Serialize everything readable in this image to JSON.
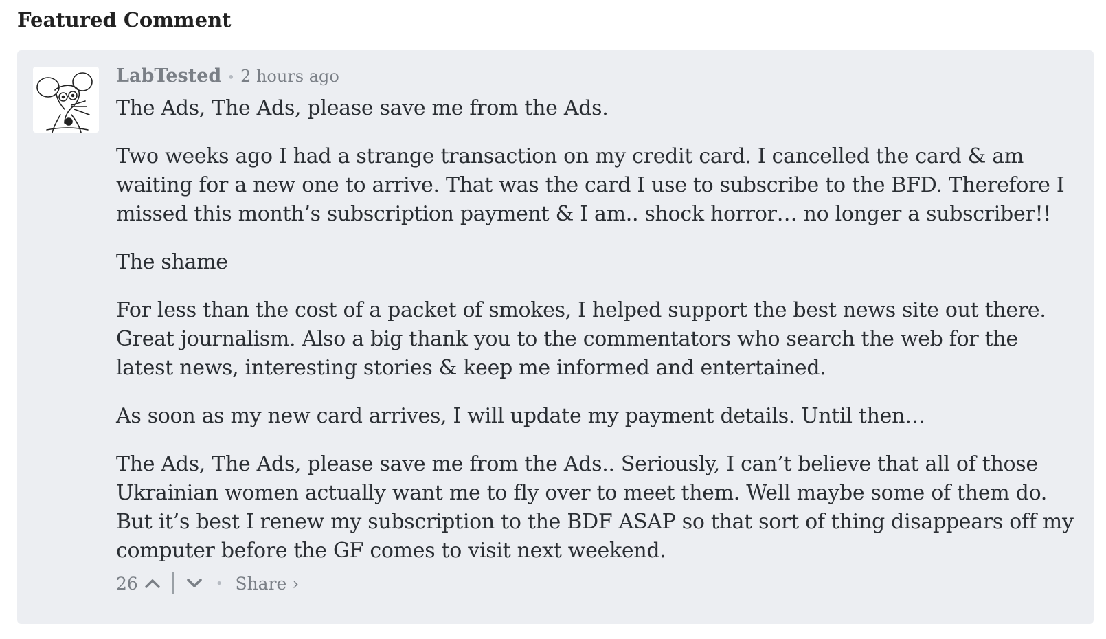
{
  "section_title": "Featured Comment",
  "comment": {
    "author": "LabTested",
    "time": "2 hours ago",
    "paragraphs": [
      "The Ads, The Ads, please save me from the Ads.",
      "Two weeks ago I had a strange transaction on my credit card. I cancelled the card & am waiting for a new one to arrive. That was the card I use to subscribe to the BFD. Therefore I missed this month’s subscription payment & I am.. shock horror… no longer a subscriber!!",
      "The shame",
      "For less than the cost of a packet of smokes, I helped support the best news site out there. Great journalism. Also a big thank you to the commentators who search the web for the latest news, interesting stories & keep me informed and entertained.",
      "As soon as my new card arrives, I will update my payment details. Until then…",
      "The Ads, The Ads, please save me from the Ads.. Seriously, I can’t believe that all of those Ukrainian women actually want me to fly over to meet them. Well maybe some of them do. But it’s best I renew my subscription to the BDF ASAP so that sort of thing disappears off my computer before the GF comes to visit next weekend."
    ],
    "votes": "26",
    "share_label": "Share ›",
    "avatar_icon": "cartoon-rat-avatar",
    "upvote_icon": "chevron-up-icon",
    "downvote_icon": "chevron-down-icon"
  },
  "colors": {
    "card_bg": "#eceef2",
    "muted_text": "#7a7f86",
    "body_text": "#2a2e33"
  }
}
